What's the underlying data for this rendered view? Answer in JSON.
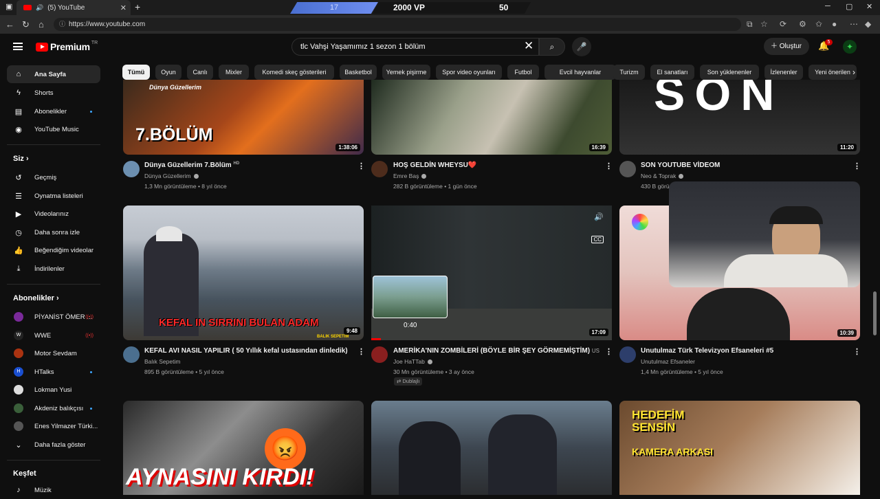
{
  "browser": {
    "tab_title": "(5) YouTube",
    "url": "https://www.youtube.com",
    "overlay": {
      "left": "17",
      "vp": "2000 VP",
      "right": "50"
    }
  },
  "masthead": {
    "logo_text": "Premium",
    "logo_country": "TR",
    "search_value": "tlc Vahşi Yaşamımız 1 sezon 1 bölüm",
    "create_label": "Oluştur",
    "notification_count": "5"
  },
  "sidebar": {
    "main": [
      {
        "label": "Ana Sayfa",
        "icon": "home-icon"
      },
      {
        "label": "Shorts",
        "icon": "shorts-icon"
      },
      {
        "label": "Abonelikler",
        "icon": "subscriptions-icon"
      },
      {
        "label": "YouTube Music",
        "icon": "music-icon"
      }
    ],
    "you_header": "Siz",
    "you": [
      {
        "label": "Geçmiş",
        "icon": "history-icon"
      },
      {
        "label": "Oynatma listeleri",
        "icon": "playlist-icon"
      },
      {
        "label": "Videolarınız",
        "icon": "your-videos-icon"
      },
      {
        "label": "Daha sonra izle",
        "icon": "watch-later-icon"
      },
      {
        "label": "Beğendiğim videolar",
        "icon": "liked-icon"
      },
      {
        "label": "İndirilenler",
        "icon": "download-icon"
      }
    ],
    "subs_header": "Abonelikler",
    "subs": [
      {
        "label": "PİYANİST ÖMER ...",
        "color": "#7a2a9a"
      },
      {
        "label": "WWE",
        "color": "#222222"
      },
      {
        "label": "Motor Sevdam",
        "color": "#aa3311"
      },
      {
        "label": "HTalks",
        "color": "#1a4fd1"
      },
      {
        "label": "Lokman Yusi",
        "color": "#dddddd"
      },
      {
        "label": "Akdeniz balıkçısı",
        "color": "#3a5f3a"
      },
      {
        "label": "Enes Yilmazer Türki...",
        "color": "#555555"
      }
    ],
    "more_label": "Daha fazla göster",
    "explore_header": "Keşfet",
    "explore": [
      {
        "label": "Müzik",
        "icon": "music-note-icon"
      }
    ]
  },
  "chips": [
    "Tümü",
    "Oyun",
    "Canlı",
    "Mixler",
    "Komedi skeç gösterileri",
    "Basketbol",
    "Yemek pişirme",
    "Spor video oyunları",
    "Futbol",
    "Evcil hayvanlar",
    "Turizm",
    "El sanatları",
    "Son yüklenenler",
    "İzlenenler",
    "Yeni önerilen"
  ],
  "videos": [
    {
      "title": "Dünya Güzellerim 7.Bölüm",
      "badge": "HD",
      "channel": "Dünya Güzellerim",
      "meta": "1,3 Mn görüntüleme • 8 yıl önce",
      "duration": "1:38:06",
      "thumb_text": "7.BÖLÜM",
      "thumb_logo": "Dünya Güzellerim"
    },
    {
      "title": "HOŞ GELDİN WHEYSU❤️",
      "badge": "",
      "channel": "Emre Baş",
      "meta": "282 B görüntüleme • 1 gün önce",
      "duration": "16:39",
      "thumb_text": "",
      "thumb_logo": ""
    },
    {
      "title": "SON YOUTUBE VİDEOM",
      "badge": "",
      "channel": "Neo & Toprak",
      "meta": "430 B görü",
      "duration": "11:20",
      "thumb_text": "SON",
      "thumb_logo": ""
    },
    {
      "title": "KEFAL AVI NASIL YAPILIR ( 50 Yıllık kefal ustasından dinledik)",
      "badge": "",
      "channel": "Balık Sepetim",
      "meta": "895 B görüntüleme • 5 yıl önce",
      "duration": "9:48",
      "thumb_text": "KEFAL IN   SIRRINI BULAN ADAM",
      "thumb_logo": "BALIK SEPETIM"
    },
    {
      "title": "AMERİKA'NIN ZOMBİLERİ (BÖYLE BİR ŞEY GÖRMEMİŞTİM)",
      "badge": "US",
      "channel": "Joe HaTTab",
      "meta": "30 Mn görüntüleme • 3 ay önce",
      "duration": "17:09",
      "thumb_text": "",
      "thumb_logo": "",
      "dubbed": "Dublajlı",
      "hover_time": "0:40"
    },
    {
      "title": "Unutulmaz Türk Televizyon Efsaneleri #5",
      "badge": "",
      "channel": "Unutulmaz Efsaneler",
      "meta": "1,4 Mn görüntüleme • 5 yıl önce",
      "duration": "10:39",
      "thumb_text": "",
      "thumb_logo": ""
    },
    {
      "title": "",
      "badge": "",
      "channel": "",
      "meta": "",
      "duration": "",
      "thumb_text": "AYNASINI KIRDI!",
      "thumb_logo": ""
    },
    {
      "title": "",
      "badge": "",
      "channel": "",
      "meta": "",
      "duration": "",
      "thumb_text": "",
      "thumb_logo": ""
    },
    {
      "title": "",
      "badge": "",
      "channel": "",
      "meta": "",
      "duration": "",
      "thumb_text": "HEDEFİM SENSİN",
      "thumb_logo": "KAMERA ARKASI"
    }
  ]
}
